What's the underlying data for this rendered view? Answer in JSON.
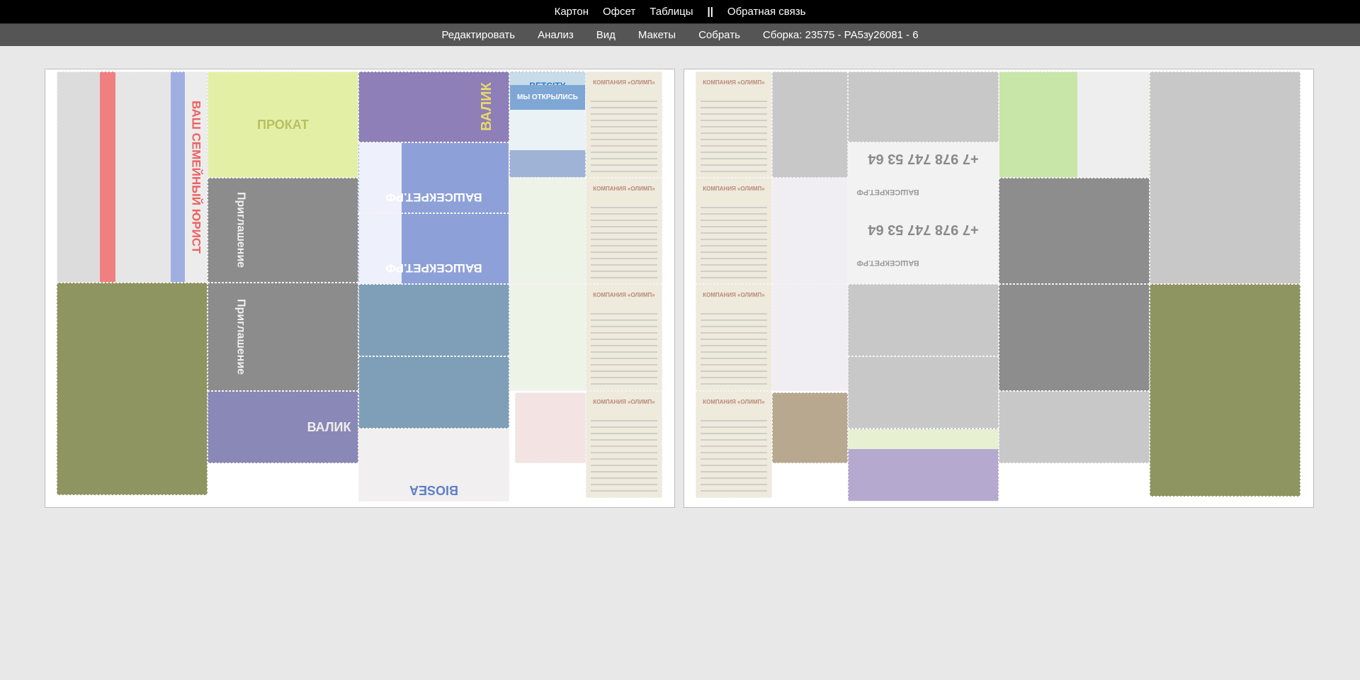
{
  "top_nav": {
    "items": [
      "Картон",
      "Офсет",
      "Таблицы"
    ],
    "separator": "||",
    "feedback": "Обратная связь"
  },
  "sub_nav": {
    "items": [
      "Редактировать",
      "Анализ",
      "Вид",
      "Макеты",
      "Собрать"
    ],
    "build_info": "Сборка: 23575 - РА5зу26081 - 6"
  },
  "sheets": {
    "left": {
      "texts": {
        "lawyer": "ВАШ СЕМЕЙНЫЙ ЮРИСТ",
        "invitation": "Приглашение",
        "valik": "ВАЛИК",
        "betcity": "BETCITY",
        "opened": "МЫ ОТКРЫЛИСЬ",
        "olimp": "КОМПАНИЯ «ОЛИМП»",
        "secret": "ВАШСЕКРЕТ.РФ",
        "biosea": "BIOSEA",
        "prokat": "ПРОКАТ"
      }
    },
    "right": {
      "texts": {
        "olimp": "КОМПАНИЯ «ОЛИМП»",
        "phone": "+7 978 747 53 64",
        "secret": "ВАШСЕКРЕТ.РФ"
      }
    }
  },
  "colors": {
    "topbar": "#000000",
    "subbar": "#555555",
    "page_bg": "#e8e8e8",
    "empty_slot": "#c8c8c8"
  }
}
